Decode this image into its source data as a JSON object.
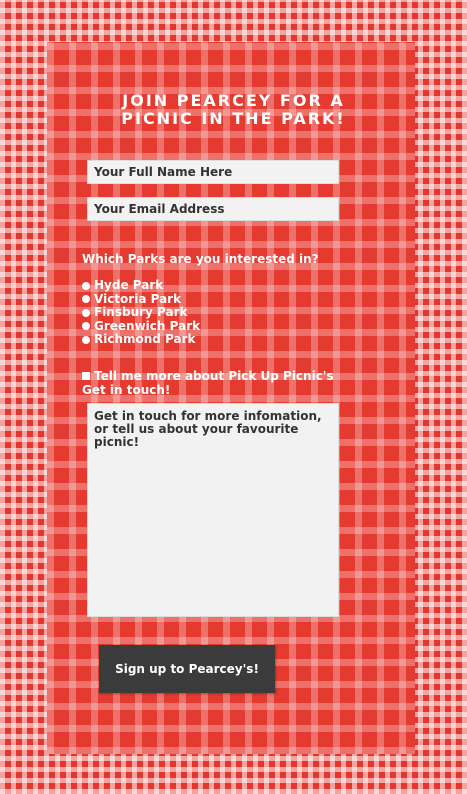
{
  "form": {
    "title_line1": "Join Pearcey for a",
    "title_line2": "picnic in the park!",
    "name_placeholder": "Your Full Name Here",
    "email_placeholder": "Your Email Address",
    "parks_question": "Which Parks are you interested in?",
    "parks": [
      {
        "label": "Hyde Park"
      },
      {
        "label": "Victoria Park"
      },
      {
        "label": "Finsbury Park"
      },
      {
        "label": "Greenwich Park"
      },
      {
        "label": "Richmond Park"
      }
    ],
    "optin_label": "Tell me more about Pick Up Picnic's",
    "get_in_touch_label": "Get in touch!",
    "message_placeholder": "Get in touch for more infomation, or tell us about your favourite picnic!",
    "submit_label": "Sign up to Pearcey's!"
  },
  "colors": {
    "gingham_red": "#e5352d",
    "field_bg": "#f2f2f2",
    "button_bg": "#3b3b3b"
  }
}
